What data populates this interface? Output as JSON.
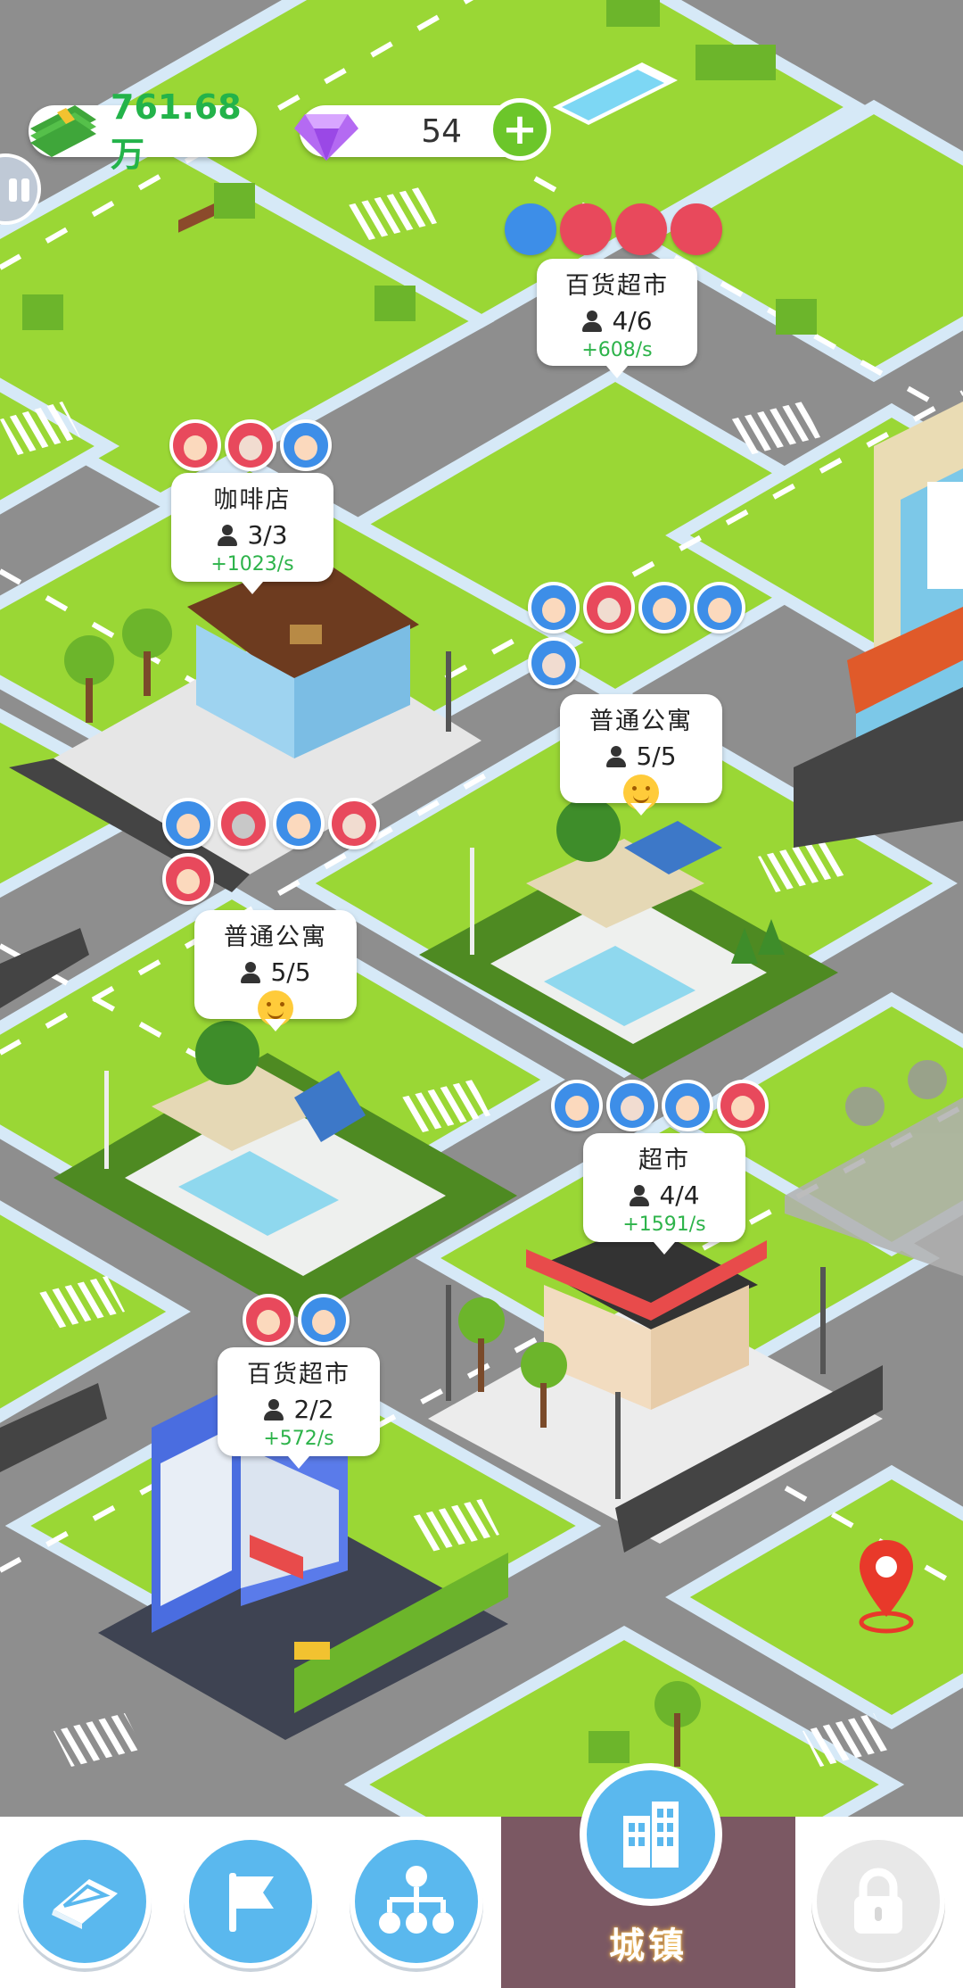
{
  "hud": {
    "money": "761.68万",
    "gems": "54",
    "plus": "+"
  },
  "buildings": [
    {
      "name": "百货超市",
      "occupancy": "4/6",
      "rate": "+608/s",
      "happy": false,
      "avatars": [
        {
          "type": "solid",
          "color": "#3d8ee8"
        },
        {
          "type": "solid",
          "color": "#e8495c"
        },
        {
          "type": "solid",
          "color": "#e8495c"
        },
        {
          "type": "solid",
          "color": "#e8495c"
        }
      ]
    },
    {
      "name": "咖啡店",
      "occupancy": "3/3",
      "rate": "+1023/s",
      "happy": false,
      "avatars": [
        {
          "type": "face",
          "color": "#e8495c"
        },
        {
          "type": "face",
          "color": "#e8495c"
        },
        {
          "type": "face",
          "color": "#3d8ee8"
        }
      ]
    },
    {
      "name": "普通公寓",
      "occupancy": "5/5",
      "rate": "",
      "happy": true,
      "avatars": [
        {
          "type": "face",
          "color": "#3d8ee8"
        },
        {
          "type": "face",
          "color": "#e8495c"
        },
        {
          "type": "face",
          "color": "#3d8ee8"
        },
        {
          "type": "face",
          "color": "#3d8ee8"
        },
        {
          "type": "face",
          "color": "#3d8ee8"
        }
      ]
    },
    {
      "name": "普通公寓",
      "occupancy": "5/5",
      "rate": "",
      "happy": true,
      "avatars": [
        {
          "type": "face",
          "color": "#3d8ee8"
        },
        {
          "type": "face",
          "color": "#e8495c"
        },
        {
          "type": "face",
          "color": "#3d8ee8"
        },
        {
          "type": "face",
          "color": "#e8495c"
        },
        {
          "type": "face",
          "color": "#e8495c"
        }
      ]
    },
    {
      "name": "超市",
      "occupancy": "4/4",
      "rate": "+1591/s",
      "happy": false,
      "avatars": [
        {
          "type": "face",
          "color": "#3d8ee8"
        },
        {
          "type": "face",
          "color": "#3d8ee8"
        },
        {
          "type": "face",
          "color": "#3d8ee8"
        },
        {
          "type": "face",
          "color": "#e8495c"
        }
      ]
    },
    {
      "name": "百货超市",
      "occupancy": "2/2",
      "rate": "+572/s",
      "happy": false,
      "avatars": [
        {
          "type": "face",
          "color": "#e8495c"
        },
        {
          "type": "face",
          "color": "#3d8ee8"
        }
      ]
    }
  ],
  "nav": {
    "items": [
      {
        "icon": "book-icon"
      },
      {
        "icon": "flag-icon"
      },
      {
        "icon": "hierarchy-icon"
      },
      {
        "icon": "town-building-icon",
        "label": "城镇",
        "active": true
      },
      {
        "icon": "lock-icon",
        "locked": true
      }
    ]
  },
  "colors": {
    "grass": "#9ad735",
    "road": "#8e8e8e",
    "accent": "#5ab8ee",
    "money": "#23b34a",
    "active_tab": "#7b5863"
  }
}
